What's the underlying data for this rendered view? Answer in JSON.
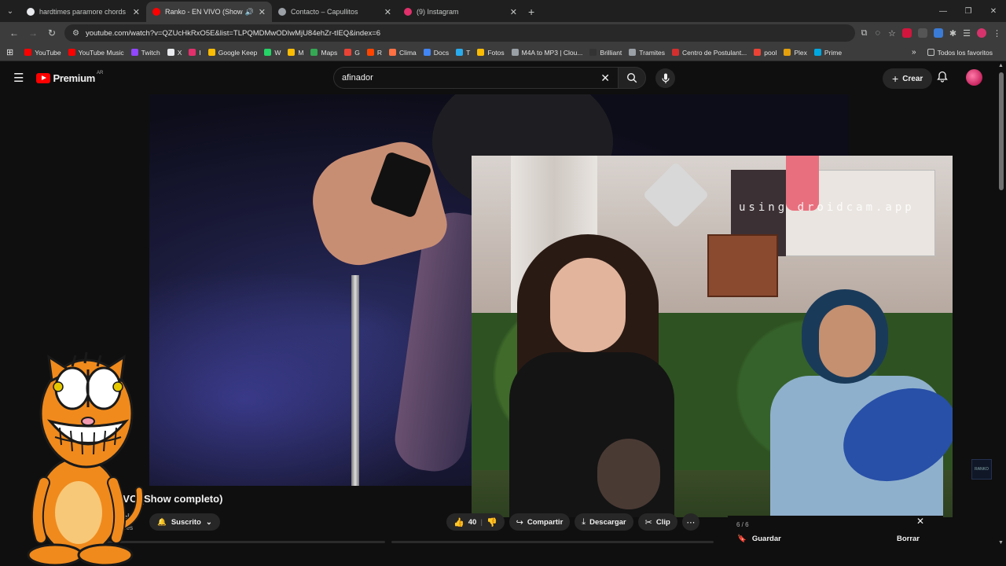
{
  "browser": {
    "tabs": [
      {
        "title": "hardtimes paramore chords - G",
        "active": false,
        "favicon_color": "#e8eaed"
      },
      {
        "title": "Ranko - EN VIVO (Show co",
        "active": true,
        "favicon_color": "#ff0000"
      },
      {
        "title": "Contacto – Capullitos",
        "active": false,
        "favicon_color": "#9aa0a6"
      },
      {
        "title": "(9) Instagram",
        "active": false,
        "favicon_color": "#e1306c"
      }
    ],
    "url": "youtube.com/watch?v=QZUcHkRxO5E&list=TLPQMDMwODIwMjU84ehZr-tIEQ&index=6",
    "bookmarks": [
      {
        "label": "YouTube",
        "color": "#ff0000"
      },
      {
        "label": "YouTube Music",
        "color": "#ff0000"
      },
      {
        "label": "Twitch",
        "color": "#9146ff"
      },
      {
        "label": "X",
        "color": "#e8eaed"
      },
      {
        "label": "I",
        "color": "#e1306c"
      },
      {
        "label": "Google Keep",
        "color": "#fbbc04"
      },
      {
        "label": "W",
        "color": "#25d366"
      },
      {
        "label": "M",
        "color": "#fbbc04"
      },
      {
        "label": "Maps",
        "color": "#34a853"
      },
      {
        "label": "G",
        "color": "#ea4335"
      },
      {
        "label": "R",
        "color": "#ff4500"
      },
      {
        "label": "Clima",
        "color": "#ff7043"
      },
      {
        "label": "Docs",
        "color": "#4285f4"
      },
      {
        "label": "T",
        "color": "#2aabee"
      },
      {
        "label": "Fotos",
        "color": "#fbbc04"
      },
      {
        "label": "M4A to MP3 | Clou...",
        "color": "#9aa0a6"
      },
      {
        "label": "Brilliant",
        "color": "#333333"
      },
      {
        "label": "Tramites",
        "color": "#9aa0a6"
      },
      {
        "label": "Centro de Postulant...",
        "color": "#d32f2f"
      },
      {
        "label": "pool",
        "color": "#ea4335"
      },
      {
        "label": "Plex",
        "color": "#e5a00d"
      },
      {
        "label": "Prime",
        "color": "#00a8e1"
      }
    ],
    "all_bookmarks": "Todos los favoritos"
  },
  "youtube": {
    "logo_word": "Premium",
    "country": "AR",
    "search_value": "afinador",
    "create_label": "Crear"
  },
  "video": {
    "title_visible": "N VIVO (Show completo)",
    "channel": "nko Oficial",
    "subs": "suscriptores",
    "subscribed_label": "Suscrito",
    "likes": "40",
    "share_label": "Compartir",
    "download_label": "Descargar",
    "clip_label": "Clip",
    "watermark": "using droidcam.app"
  },
  "playlist": {
    "count": "6 / 6",
    "save_label": "Guardar",
    "clear_label": "Borrar"
  },
  "corner_badge": "RANKO"
}
